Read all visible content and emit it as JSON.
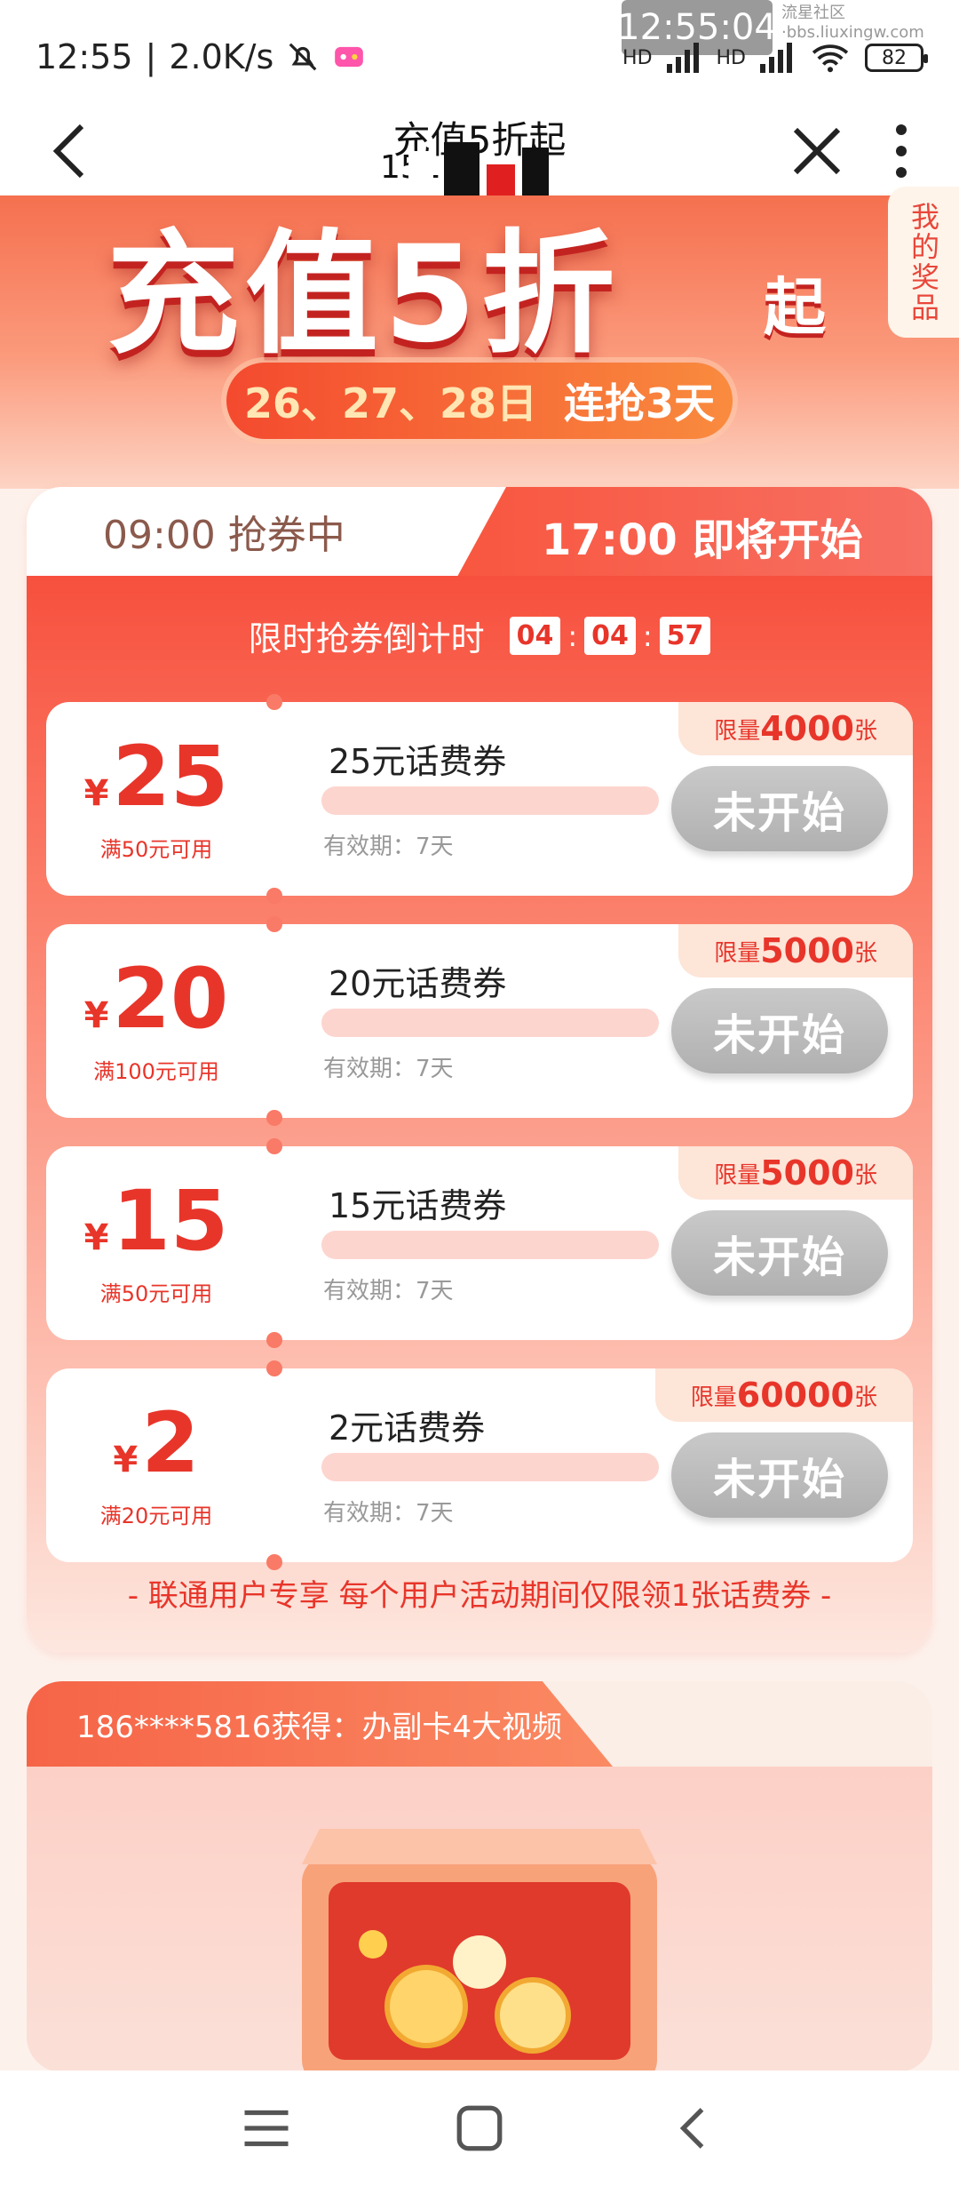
{
  "status_bar": {
    "time": "12:55",
    "speed": "2.0K/s",
    "overlay_time": "12:55:04",
    "watermark": "流星社区·bbs.liuxingw.com",
    "network_labels": [
      "HD",
      "HD"
    ],
    "battery": "82"
  },
  "nav": {
    "title": "充值5折起",
    "subtitle": "151"
  },
  "banner": {
    "title": "充值5折",
    "title_suffix": "起",
    "dates": "26、27、28日",
    "days": "连抢3天",
    "prize_tab": "我的奖品"
  },
  "tabs": {
    "left": "09:00 抢券中",
    "right": "17:00 即将开始"
  },
  "countdown": {
    "label": "限时抢券倒计时",
    "h": "04",
    "m": "04",
    "s": "57"
  },
  "coupons": [
    {
      "amount": "25",
      "yen": "¥",
      "condition": "满50元可用",
      "name": "25元话费券",
      "valid": "有效期：7天",
      "limit_prefix": "限量",
      "limit": "4000",
      "limit_suffix": "张",
      "button": "未开始"
    },
    {
      "amount": "20",
      "yen": "¥",
      "condition": "满100元可用",
      "name": "20元话费券",
      "valid": "有效期：7天",
      "limit_prefix": "限量",
      "limit": "5000",
      "limit_suffix": "张",
      "button": "未开始"
    },
    {
      "amount": "15",
      "yen": "¥",
      "condition": "满50元可用",
      "name": "15元话费券",
      "valid": "有效期：7天",
      "limit_prefix": "限量",
      "limit": "5000",
      "limit_suffix": "张",
      "button": "未开始"
    },
    {
      "amount": "2",
      "yen": "¥",
      "condition": "满20元可用",
      "name": "2元话费券",
      "valid": "有效期：7天",
      "limit_prefix": "限量",
      "limit": "60000",
      "limit_suffix": "张",
      "button": "未开始"
    }
  ],
  "footnote": "- 联通用户专享 每个用户活动期间仅限领1张话费券 -",
  "winner": {
    "text": "186****5816获得：办副卡4大视频"
  },
  "colors": {
    "accent": "#e8352a",
    "banner": "#f5704f",
    "disabled_button": "#b8b8b8"
  },
  "icons": [
    "mute-bell-icon",
    "game-icon",
    "signal-icon",
    "wifi-icon",
    "battery-icon",
    "back-icon",
    "close-icon",
    "more-icon",
    "menu-icon",
    "home-icon",
    "nav-back-icon"
  ]
}
